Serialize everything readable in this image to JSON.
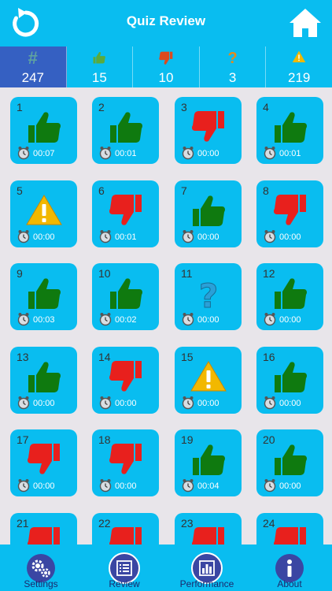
{
  "header": {
    "title": "Quiz Review",
    "back_icon": "refresh-back-icon",
    "home_icon": "home-icon"
  },
  "stats": [
    {
      "icon": "hash-icon",
      "value": "247",
      "active": true
    },
    {
      "icon": "thumbs-up-icon",
      "value": "15"
    },
    {
      "icon": "thumbs-down-icon",
      "value": "10"
    },
    {
      "icon": "question-icon",
      "value": "3"
    },
    {
      "icon": "warning-icon",
      "value": "219"
    }
  ],
  "tiles": [
    {
      "num": "1",
      "status": "up",
      "time": "00:07"
    },
    {
      "num": "2",
      "status": "up",
      "time": "00:01"
    },
    {
      "num": "3",
      "status": "down",
      "time": "00:00"
    },
    {
      "num": "4",
      "status": "up",
      "time": "00:01"
    },
    {
      "num": "5",
      "status": "warning",
      "time": "00:00"
    },
    {
      "num": "6",
      "status": "down",
      "time": "00:01"
    },
    {
      "num": "7",
      "status": "up",
      "time": "00:00"
    },
    {
      "num": "8",
      "status": "down",
      "time": "00:00"
    },
    {
      "num": "9",
      "status": "up",
      "time": "00:03"
    },
    {
      "num": "10",
      "status": "up",
      "time": "00:02"
    },
    {
      "num": "11",
      "status": "question",
      "time": "00:00"
    },
    {
      "num": "12",
      "status": "up",
      "time": "00:00"
    },
    {
      "num": "13",
      "status": "up",
      "time": "00:00"
    },
    {
      "num": "14",
      "status": "down",
      "time": "00:00"
    },
    {
      "num": "15",
      "status": "warning",
      "time": "00:00"
    },
    {
      "num": "16",
      "status": "up",
      "time": "00:00"
    },
    {
      "num": "17",
      "status": "down",
      "time": "00:00"
    },
    {
      "num": "18",
      "status": "down",
      "time": "00:00"
    },
    {
      "num": "19",
      "status": "up",
      "time": "00:04"
    },
    {
      "num": "20",
      "status": "up",
      "time": "00:00"
    },
    {
      "num": "21",
      "status": "down",
      "time": ""
    },
    {
      "num": "22",
      "status": "down",
      "time": ""
    },
    {
      "num": "23",
      "status": "down",
      "time": ""
    },
    {
      "num": "24",
      "status": "down",
      "time": ""
    }
  ],
  "tabs": [
    {
      "label": "Settings",
      "icon": "gears-icon"
    },
    {
      "label": "Review",
      "icon": "list-icon",
      "active": true
    },
    {
      "label": "Performance",
      "icon": "bar-chart-icon"
    },
    {
      "label": "About",
      "icon": "info-icon"
    }
  ],
  "colors": {
    "bar": "#09bdf0",
    "active_stat": "#3560c2",
    "thumb_up": "#0f7a0f",
    "thumb_down": "#e8201d",
    "question": "#2aa0d8",
    "warning": "#f2b800",
    "tab_circle": "#3a46a3"
  }
}
